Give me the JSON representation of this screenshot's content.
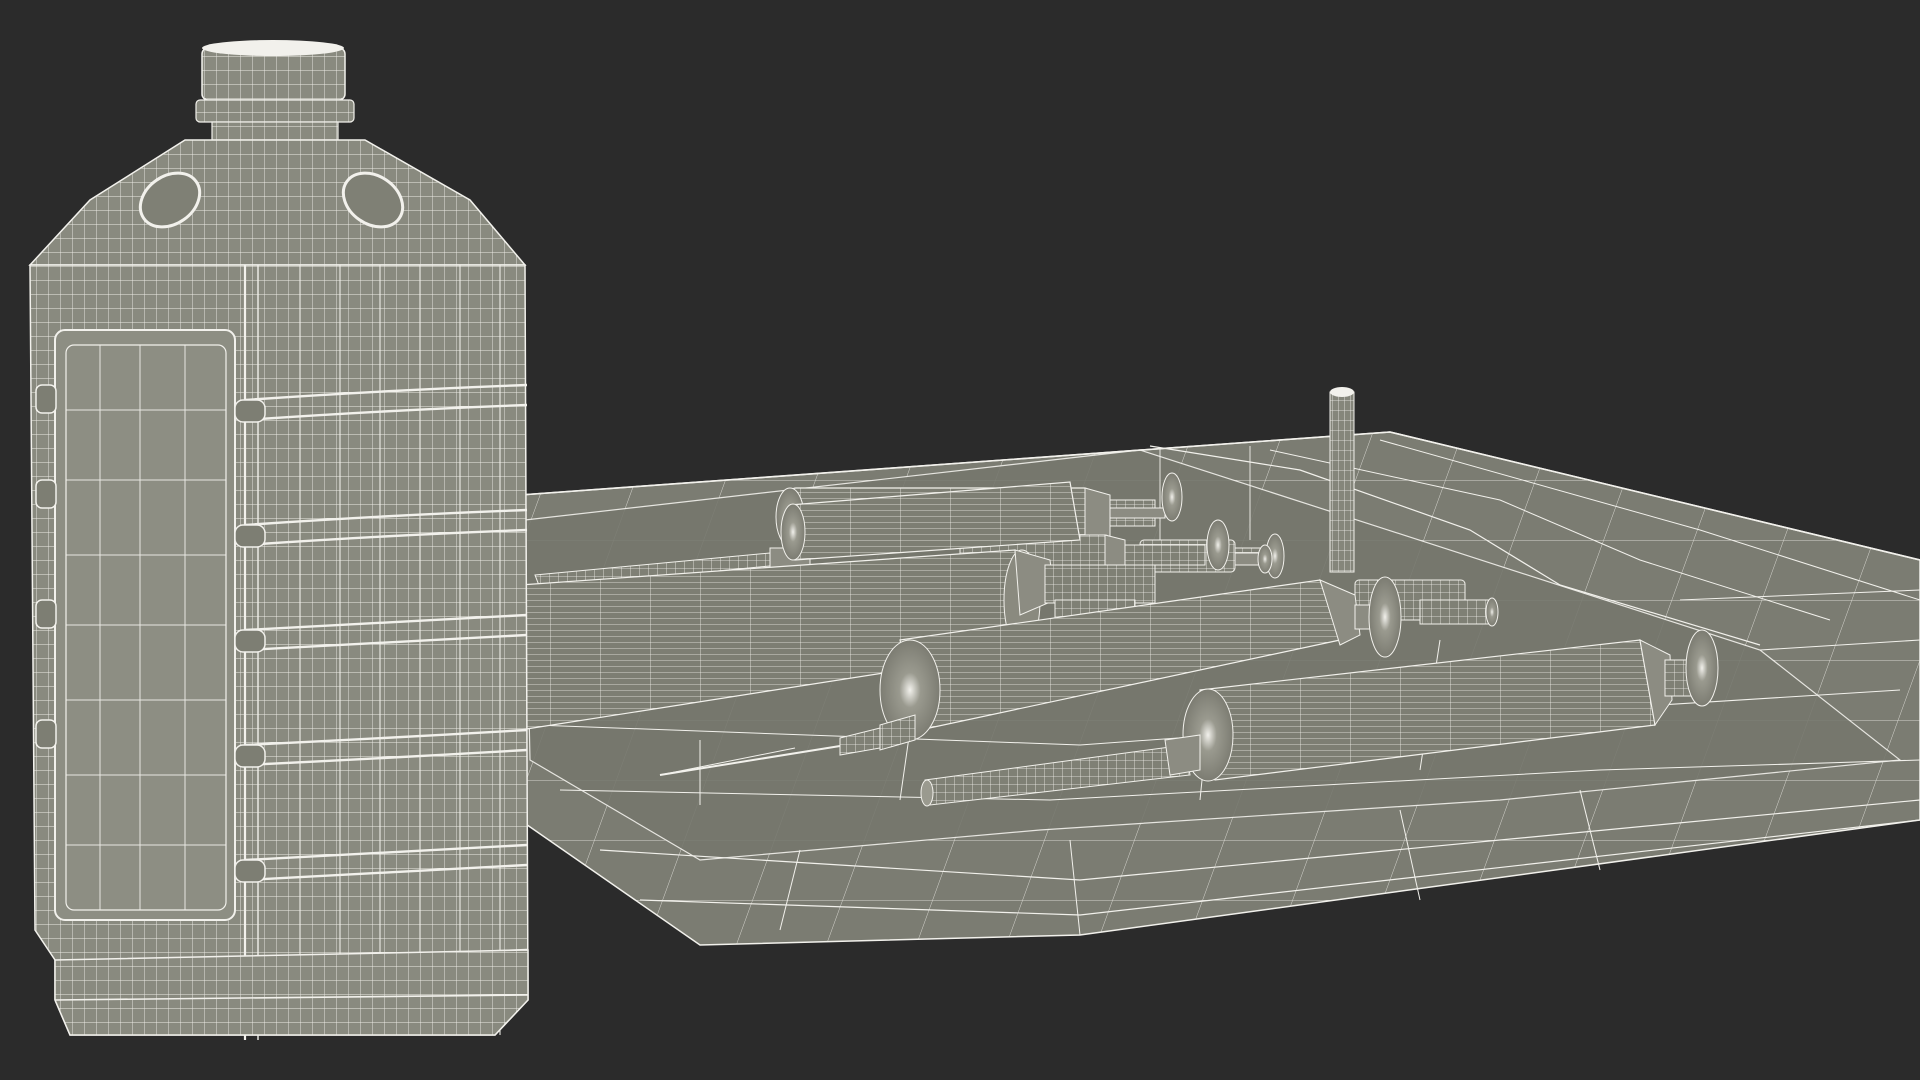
{
  "scene": {
    "background": "#2b2b2b",
    "wireframe_color": "#f2f1ec",
    "surface_color": "#8a8a7e",
    "surface_dark": "#6f6f65",
    "surface_light": "#9d9d91",
    "objects": [
      "plastic-bottle",
      "medical-tray",
      "syringe-large-back",
      "syringe-large-front",
      "syringe-medium",
      "syringe-small",
      "syringe-with-needle",
      "syringe-with-tip",
      "vertical-rod"
    ]
  }
}
